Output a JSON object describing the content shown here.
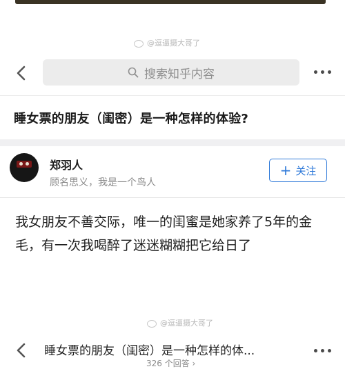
{
  "watermark": {
    "text": "@逗逼摄大哥了"
  },
  "search": {
    "placeholder": "搜索知乎内容"
  },
  "question": {
    "title": "睡女票的朋友（闺密）是一种怎样的体验?"
  },
  "author": {
    "name": "郑羽人",
    "bio": "顾名思义，我是一个鸟人",
    "follow_label": "关注"
  },
  "answer": {
    "text": "我女朋友不善交际，唯一的闺蜜是她家养了5年的金毛，有一次我喝醉了迷迷糊糊把它给日了"
  },
  "bottom_bar": {
    "title": "睡女票的朋友（闺密）是一种怎样的体...",
    "count": "326 个回答 ›"
  },
  "colors": {
    "accent": "#2f7ad9"
  },
  "icons": [
    "back-chevron-icon",
    "search-icon",
    "more-dots-icon",
    "plus-icon",
    "weibo-logo-icon"
  ]
}
